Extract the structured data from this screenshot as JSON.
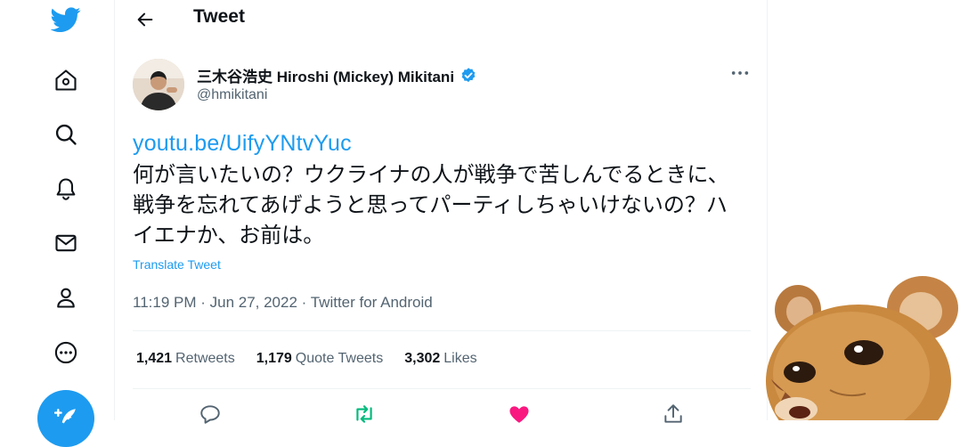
{
  "header": {
    "title": "Tweet"
  },
  "tweet": {
    "author_name": "三木谷浩史 Hiroshi (Mickey) Mikitani",
    "handle": "@hmikitani",
    "link": "youtu.be/UifyYNtvYuc",
    "text": "何が言いたいの？ウクライナの人が戦争で苦しんでるときに、戦争を忘れてあげようと思ってパーティしちゃいけないの？ハイエナか、お前は。",
    "translate_label": "Translate Tweet",
    "meta": "11:19 PM · Jun 27, 2022 · Twitter for Android",
    "stats": {
      "retweets_count": "1,421",
      "retweets_label": "Retweets",
      "quotes_count": "1,179",
      "quotes_label": "Quote Tweets",
      "likes_count": "3,302",
      "likes_label": "Likes"
    }
  },
  "sidebar": {
    "icons": [
      "twitter-logo",
      "home-icon",
      "search-icon",
      "notifications-icon",
      "messages-icon",
      "profile-icon",
      "more-icon",
      "compose-icon"
    ]
  },
  "colors": {
    "accent": "#1d9bf0",
    "retweet": "#00ba7c",
    "like": "#f91880",
    "text": "#0f1419",
    "secondary": "#536471"
  }
}
